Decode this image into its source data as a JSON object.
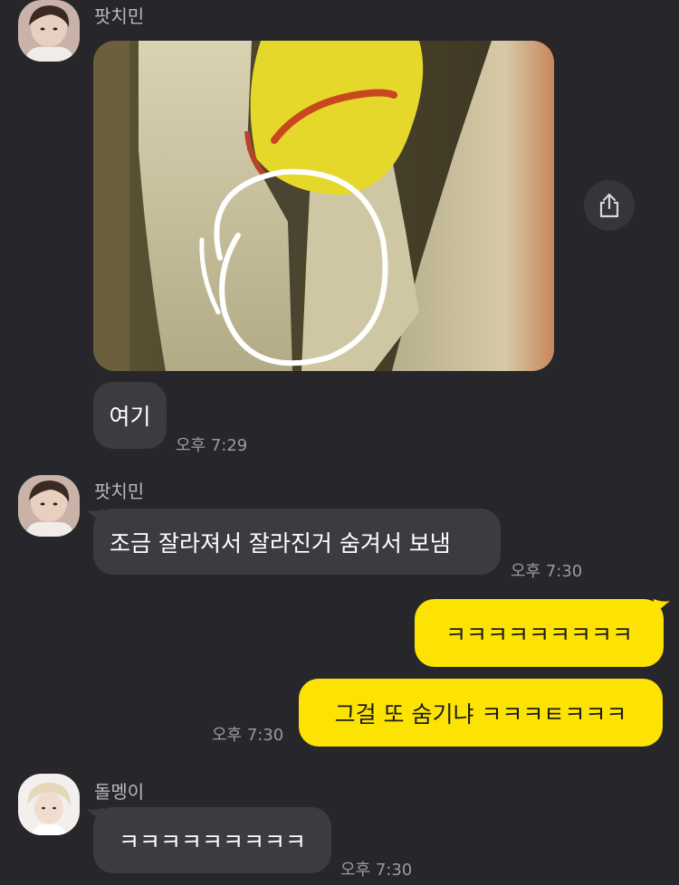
{
  "messages": [
    {
      "sender": "팟치민",
      "kind": "image"
    },
    {
      "sender": "팟치민",
      "text": "여기",
      "time": "오후 7:29"
    },
    {
      "sender": "팟치민",
      "text": "조금 잘라져서 잘라진거 숨겨서 보냄",
      "time": "오후 7:30"
    },
    {
      "sender": "me",
      "text": "ㅋㅋㅋㅋㅋㅋㅋㅋㅋ"
    },
    {
      "sender": "me",
      "text": "그걸 또 숨기냐 ㅋㅋㅋㅌㅋㅋㅋ",
      "time": "오후 7:30"
    },
    {
      "sender": "돌멩이",
      "text": "ㅋㅋㅋㅋㅋㅋㅋㅋㅋ",
      "time": "오후 7:30"
    }
  ],
  "icons": {
    "share": "share-icon"
  },
  "colors": {
    "background": "#27272b",
    "incoming_bubble": "#3b3b40",
    "outgoing_bubble": "#fde304",
    "photo_circle": "#ffffff"
  }
}
